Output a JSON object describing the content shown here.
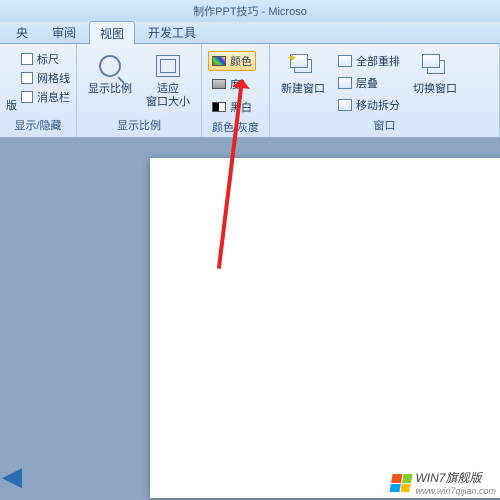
{
  "title": "制作PPT技巧 - Microso",
  "tabs": {
    "t1": "央",
    "t2": "审阅",
    "t3": "视图",
    "t4": "开发工具"
  },
  "groups": {
    "showhide": {
      "label": "显示/隐藏",
      "partial": "版",
      "items": {
        "ruler": "标尺",
        "gridlines": "网格线",
        "msgbar": "消息栏"
      }
    },
    "zoom": {
      "label": "显示比例",
      "zoom": "显示比例",
      "fit": "适应\n窗口大小"
    },
    "color": {
      "label": "颜色/灰度",
      "color": "颜色",
      "gray": "度",
      "blackwhite": "黑白"
    },
    "window": {
      "label": "窗口",
      "newwin": "新建窗口",
      "arrange": "全部重排",
      "cascade": "层叠",
      "movesplit": "移动拆分",
      "switch": "切换窗口"
    }
  },
  "watermark": {
    "text": "WIN7旗舰版",
    "url": "www.win7qijian.com"
  }
}
